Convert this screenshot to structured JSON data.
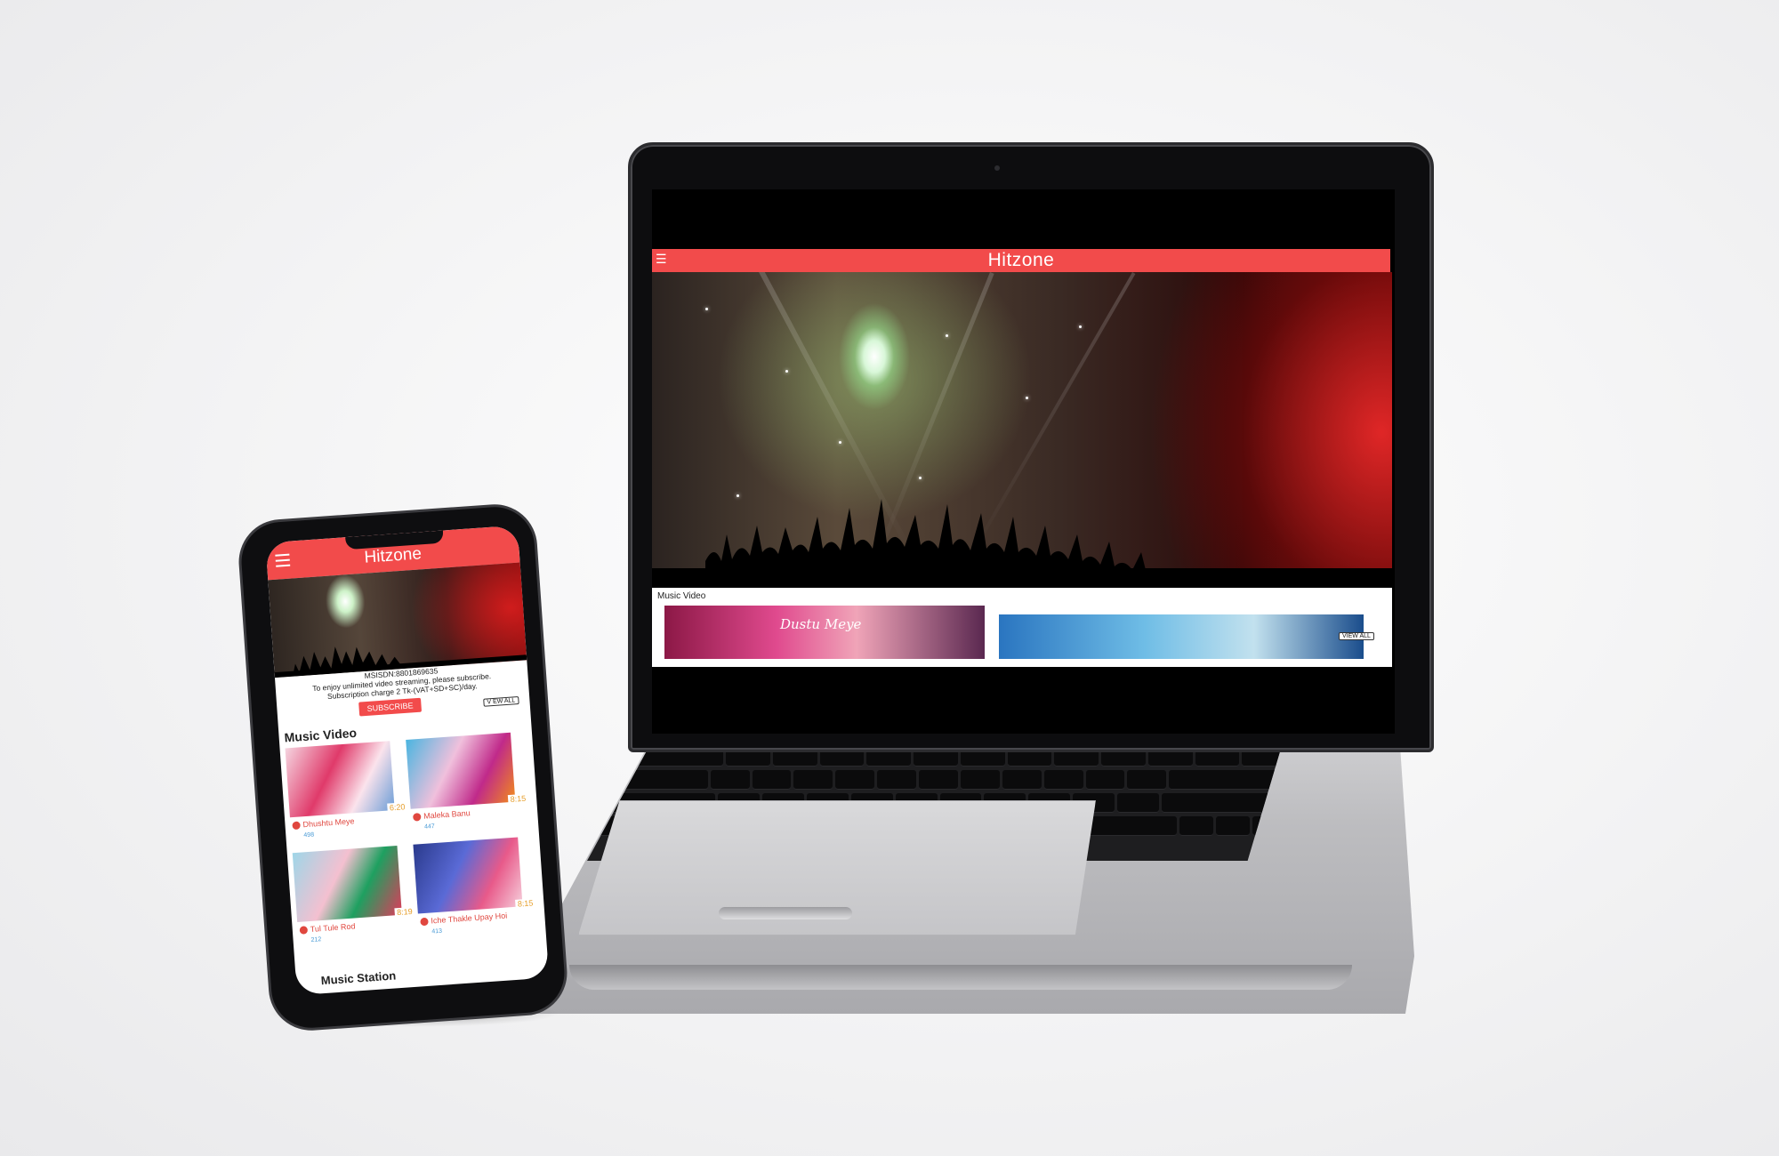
{
  "laptop": {
    "app_title": "Hitzone",
    "menu_icon": "hamburger-icon",
    "section_title": "Music Video",
    "view_all_label": "VIEW ALL",
    "thumb_1_caption": "Dustu Meye"
  },
  "phone": {
    "app_title": "Hitzone",
    "menu_icon": "hamburger-icon",
    "msisdn_line": "MSISDN:8801869635",
    "promo_line_1": "To enjoy unlimited video streaming, please subscribe.",
    "promo_line_2": "Subscription charge 2 Tk-(VAT+SD+SC)/day.",
    "subscribe_label": "SUBSCRIBE",
    "view_all_label": "V EW ALL",
    "section_title": "Music Video",
    "cards": [
      {
        "title": "Dhushtu Meye",
        "duration": "6:20",
        "views": "498"
      },
      {
        "title": "Maleka Banu",
        "duration": "8:15",
        "views": "447"
      },
      {
        "title": "Tul Tule Rod",
        "duration": "8:19",
        "views": "212"
      },
      {
        "title": "Iche Thakle Upay Hoi",
        "duration": "8:15",
        "views": "413"
      }
    ],
    "next_section_title": "Music Station"
  },
  "colors": {
    "brand_red": "#f24b4b",
    "title_red": "#e0473f",
    "duration_orange": "#e69e2a",
    "views_blue": "#4a9bd6"
  }
}
